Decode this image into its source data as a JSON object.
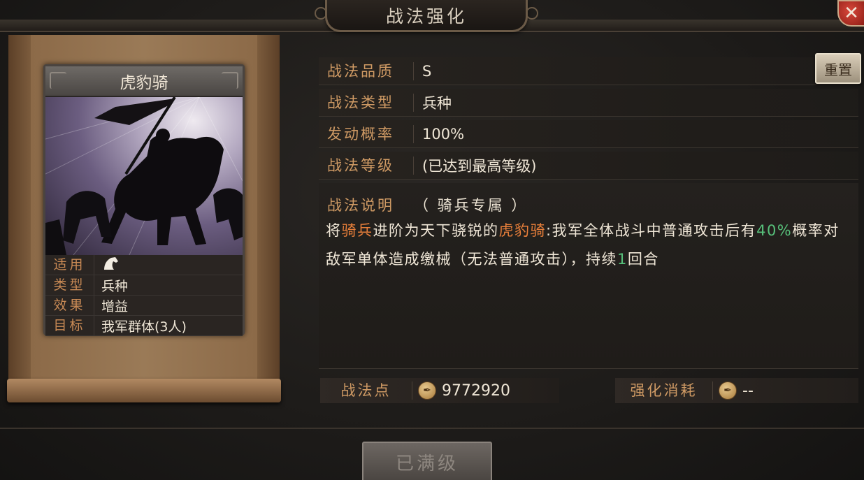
{
  "window": {
    "title": "战法强化",
    "close_symbol": "✕"
  },
  "card": {
    "name": "虎豹骑",
    "rows": [
      {
        "key": "适用",
        "value": ""
      },
      {
        "key": "类型",
        "value": "兵种"
      },
      {
        "key": "效果",
        "value": "增益"
      },
      {
        "key": "目标",
        "value": "我军群体(3人)"
      }
    ],
    "applies_icon": "horse-head-icon"
  },
  "info": {
    "quality_label": "战法品质",
    "quality_value": "S",
    "type_label": "战法类型",
    "type_value": "兵种",
    "chance_label": "发动概率",
    "chance_value": "100%",
    "level_label": "战法等级",
    "level_value": "(已达到最高等级)",
    "reset_label": "重置"
  },
  "description": {
    "label": "战法说明",
    "tag": "（ 骑兵专属 ）",
    "p1": "将",
    "p2": "骑兵",
    "p3": "进阶为天下骁锐的",
    "p4": "虎豹骑",
    "p5": ":我军全体战斗中普通攻击后有",
    "p6": "40%",
    "p7": "概率对敌军单体造成缴械（无法普通攻击），持续",
    "p8": "1",
    "p9": "回合"
  },
  "points": {
    "label": "战法点",
    "value": "9772920",
    "cost_label": "强化消耗",
    "cost_value": "--",
    "coin_icon": "quill-coin-icon"
  },
  "footer": {
    "button_label": "已满级"
  },
  "colors": {
    "label": "#cf9a64",
    "highlight_orange": "#e87f3a",
    "highlight_green": "#57c07a",
    "text": "#efe6d6"
  }
}
